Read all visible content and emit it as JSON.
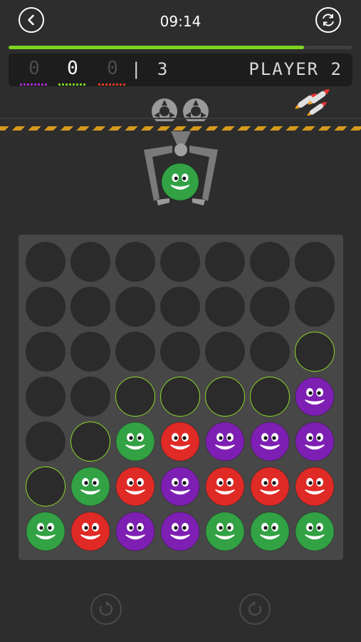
{
  "header": {
    "timer": "09:14",
    "back_icon": "chevron-left-icon",
    "refresh_icon": "swap-arrows-icon"
  },
  "progress": {
    "fraction": 0.86,
    "color": "#7cd320"
  },
  "scoreboard": {
    "scores": [
      {
        "value": "0",
        "state": "dim",
        "underline": "#a52bd0"
      },
      {
        "value": "0",
        "state": "active",
        "underline": "#7cd320"
      },
      {
        "value": "0",
        "state": "dim",
        "underline": "#e03a24"
      }
    ],
    "total": "| 3",
    "player_label": "PLAYER 2"
  },
  "current_disc": "green",
  "colors": {
    "green": "#32a244",
    "red": "#e02a26",
    "purple": "#7e1fb3",
    "hint": "#8bd72b",
    "hole": "#2b2b2b",
    "board": "#474747"
  },
  "board": {
    "rows": [
      [
        "empty",
        "empty",
        "empty",
        "empty",
        "empty",
        "empty",
        "empty"
      ],
      [
        "empty",
        "empty",
        "empty",
        "empty",
        "empty",
        "empty",
        "empty"
      ],
      [
        "empty",
        "empty",
        "empty",
        "empty",
        "empty",
        "empty",
        "hint"
      ],
      [
        "empty",
        "empty",
        "hint",
        "hint",
        "hint",
        "hint",
        "purple"
      ],
      [
        "empty",
        "hint",
        "green",
        "red",
        "purple",
        "purple",
        "purple"
      ],
      [
        "hint",
        "green",
        "red",
        "purple",
        "red",
        "red",
        "red"
      ],
      [
        "green",
        "red",
        "purple",
        "purple",
        "green",
        "green",
        "green"
      ]
    ]
  },
  "footer": {
    "undo_icon": "undo-icon",
    "redo_icon": "redo-icon"
  }
}
